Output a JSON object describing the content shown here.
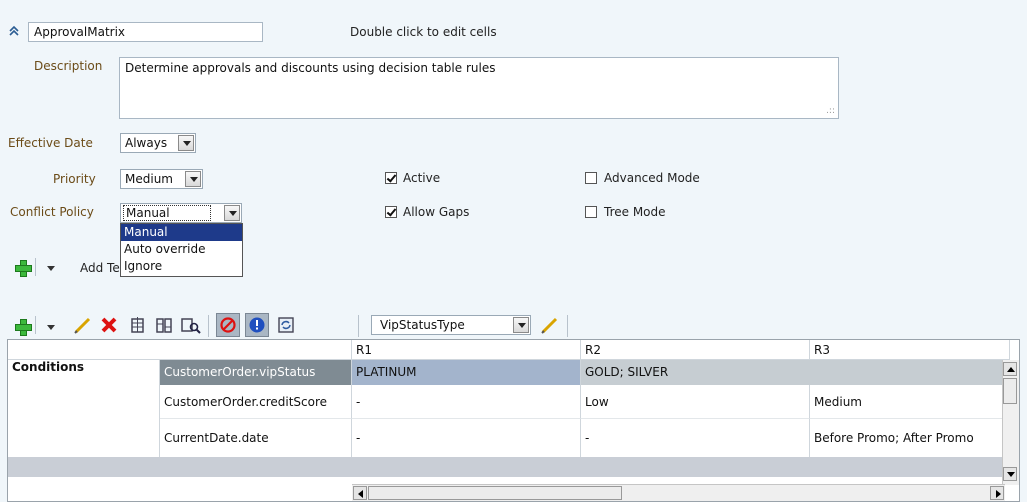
{
  "header": {
    "collapse_icon": "double-chevron-up-icon",
    "name_value": "ApprovalMatrix",
    "hint": "Double click to edit cells"
  },
  "form": {
    "description_label": "Description",
    "description_value": "Determine approvals and discounts using decision table rules",
    "effective_date_label": "Effective Date",
    "effective_date_value": "Always",
    "priority_label": "Priority",
    "priority_value": "Medium",
    "conflict_policy_label": "Conflict Policy",
    "conflict_policy_value": "Manual",
    "active_label": "Active",
    "active_checked": true,
    "allow_gaps_label": "Allow Gaps",
    "allow_gaps_checked": true,
    "advanced_mode_label": "Advanced Mode",
    "advanced_mode_checked": false,
    "tree_mode_label": "Tree Mode",
    "tree_mode_checked": false
  },
  "conflict_dropdown": {
    "options": [
      "Manual",
      "Auto override",
      "Ignore"
    ],
    "selected_index": 0
  },
  "add_test_toolbar": {
    "label_visible": "Add Te"
  },
  "table_toolbar": {
    "type_select_value": "VipStatusType",
    "icons": [
      "add-icon",
      "dropdown-arrow-icon",
      "edit-icon",
      "delete-icon",
      "column-icon",
      "split-icon",
      "find-icon",
      "no-gap-icon",
      "conflict-icon",
      "refresh-icon",
      "edit-type-icon"
    ]
  },
  "table": {
    "rule_headers": [
      "R1",
      "R2",
      "R3"
    ],
    "section_label": "Conditions",
    "rows": [
      {
        "condition": "CustomerOrder.vipStatus",
        "r1": "PLATINUM",
        "r2": "GOLD; SILVER",
        "r3": ""
      },
      {
        "condition": "CustomerOrder.creditScore",
        "r1": "-",
        "r2": "Low",
        "r3": "Medium"
      },
      {
        "condition": "CurrentDate.date",
        "r1": "-",
        "r2": "-",
        "r3": "Before Promo; After Promo"
      }
    ]
  },
  "colors": {
    "background": "#f0f6fa",
    "label_brown": "#6b4b17",
    "dropdown_selected": "#1e3a8a",
    "row_selected_condition": "#7f8b93",
    "row_selected_r1": "#a3b4cc",
    "row_selected_rest": "#c6cdd2"
  }
}
